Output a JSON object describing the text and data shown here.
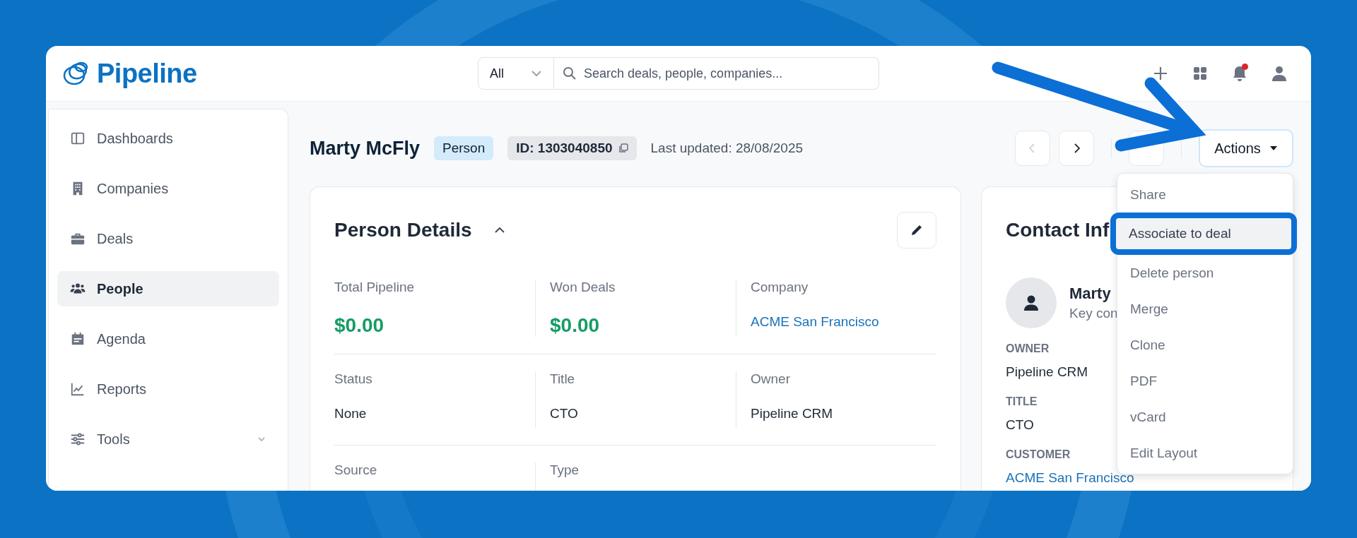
{
  "brand": {
    "name": "Pipeline"
  },
  "search": {
    "scope": "All",
    "placeholder": "Search deals, people, companies..."
  },
  "notifications": {
    "unread": true
  },
  "sidebar": {
    "items": [
      {
        "label": "Dashboards",
        "selected": false
      },
      {
        "label": "Companies",
        "selected": false
      },
      {
        "label": "Deals",
        "selected": false
      },
      {
        "label": "People",
        "selected": true
      },
      {
        "label": "Agenda",
        "selected": false
      },
      {
        "label": "Reports",
        "selected": false
      },
      {
        "label": "Tools",
        "selected": false,
        "expandable": true
      }
    ]
  },
  "record": {
    "name": "Marty McFly",
    "type_badge": "Person",
    "id": "ID: 1303040850",
    "last_updated": "Last updated: 28/08/2025"
  },
  "nav": {
    "previous_disabled": true,
    "next_disabled": false
  },
  "actions": {
    "label": "Actions",
    "menu": [
      {
        "label": "Share",
        "selected": false
      },
      {
        "label": "Associate to deal",
        "selected": true
      },
      {
        "label": "Delete person",
        "selected": false
      },
      {
        "label": "Merge",
        "selected": false
      },
      {
        "label": "Clone",
        "selected": false
      },
      {
        "label": "PDF",
        "selected": false
      },
      {
        "label": "vCard",
        "selected": false
      },
      {
        "label": "Edit Layout",
        "selected": false
      }
    ]
  },
  "details": {
    "title": "Person Details",
    "expanded": true,
    "rows": [
      [
        {
          "label": "Total Pipeline",
          "value": "$0.00",
          "kind": "money"
        },
        {
          "label": "Won Deals",
          "value": "$0.00",
          "kind": "money"
        },
        {
          "label": "Company",
          "value": "ACME San Francisco",
          "kind": "link"
        }
      ],
      [
        {
          "label": "Status",
          "value": "None",
          "kind": "text"
        },
        {
          "label": "Title",
          "value": "CTO",
          "kind": "text"
        },
        {
          "label": "Owner",
          "value": "Pipeline CRM",
          "kind": "text"
        }
      ],
      [
        {
          "label": "Source"
        },
        {
          "label": "Type"
        }
      ]
    ]
  },
  "contact": {
    "title": "Contact Inf",
    "name": "Marty",
    "subtitle": "Key con",
    "fields": [
      {
        "label": "OWNER",
        "value": "Pipeline CRM",
        "kind": "text"
      },
      {
        "label": "TITLE",
        "value": "CTO",
        "kind": "text"
      },
      {
        "label": "CUSTOMER",
        "value": "ACME San Francisco",
        "kind": "link"
      }
    ]
  }
}
